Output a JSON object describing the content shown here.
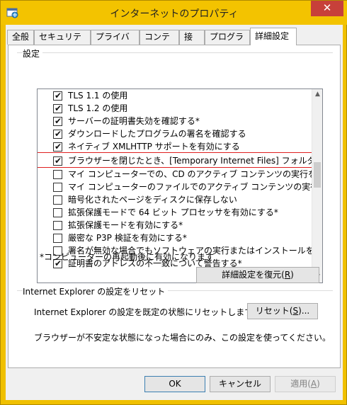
{
  "window": {
    "title": "インターネットのプロパティ",
    "close_glyph": "✕"
  },
  "tabs": [
    {
      "label": "全般"
    },
    {
      "label": "セキュリティ"
    },
    {
      "label": "プライバシー"
    },
    {
      "label": "コンテンツ"
    },
    {
      "label": "接続"
    },
    {
      "label": "プログラム"
    },
    {
      "label": "詳細設定",
      "active": true
    }
  ],
  "settings_group": {
    "label": "設定"
  },
  "settings_list": [
    {
      "text": "TLS 1.1 の使用",
      "checked": true
    },
    {
      "text": "TLS 1.2 の使用",
      "checked": true
    },
    {
      "text": "サーバーの証明書失効を確認する*",
      "checked": true
    },
    {
      "text": "ダウンロードしたプログラムの署名を確認する",
      "checked": true
    },
    {
      "text": "ネイティブ XMLHTTP サポートを有効にする",
      "checked": true
    },
    {
      "text": "ブラウザーを閉じたとき、[Temporary Internet Files] フォルダーを空",
      "checked": true,
      "highlighted": true
    },
    {
      "text": "マイ コンピューターでの、CD のアクティブ コンテンツの実行を許可する*",
      "checked": false
    },
    {
      "text": "マイ コンピューターのファイルでのアクティブ コンテンツの実行を許可する*",
      "checked": false
    },
    {
      "text": "暗号化されたページをディスクに保存しない",
      "checked": false
    },
    {
      "text": "拡張保護モードで 64 ビット プロセッサを有効にする*",
      "checked": false
    },
    {
      "text": "拡張保護モードを有効にする*",
      "checked": false
    },
    {
      "text": "厳密な P3P 検証を有効にする*",
      "checked": false
    },
    {
      "text": "署名が無効な場合でもソフトウェアの実行またはインストールを許可する",
      "checked": false
    },
    {
      "text": "証明書のアドレスの不一致について警告する*",
      "checked": true
    }
  ],
  "restart_note": "*コンピューターの再起動後に有効になります",
  "restore_button": {
    "label": "詳細設定を復元(",
    "accel": "R",
    "suffix": ")"
  },
  "reset_group": {
    "label": "Internet Explorer の設定をリセット",
    "description": "Internet Explorer の設定を既定の状態にリセットします。",
    "button": {
      "label": "リセット(",
      "accel": "S",
      "suffix": ")..."
    },
    "hint": "ブラウザーが不安定な状態になった場合にのみ、この設定を使ってください。"
  },
  "footer": {
    "ok": "OK",
    "cancel": "キャンセル",
    "apply": {
      "label": "適用(",
      "accel": "A",
      "suffix": ")"
    }
  }
}
